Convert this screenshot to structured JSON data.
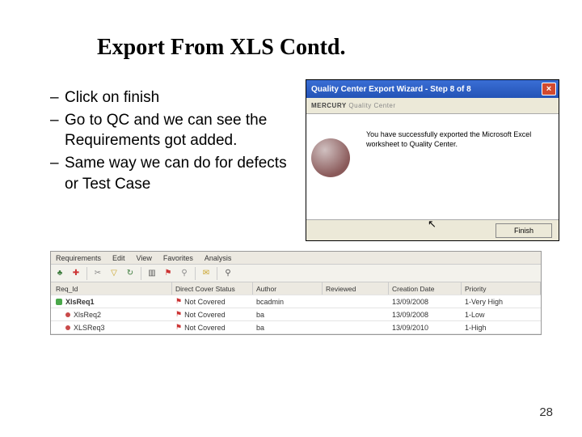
{
  "slide": {
    "title": "Export From XLS Contd.",
    "bullets": [
      "Click on finish",
      "Go to QC and we can see the Requirements got added.",
      "Same way we can do for defects or Test Case"
    ],
    "page_number": "28"
  },
  "dialog": {
    "title": "Quality Center Export Wizard - Step 8 of 8",
    "brand": "MERCURY",
    "brand_sub": "Quality Center",
    "message": "You have successfully exported the Microsoft Excel worksheet to Quality Center.",
    "finish_label": "Finish"
  },
  "qc": {
    "menu": [
      "Requirements",
      "Edit",
      "View",
      "Favorites",
      "Analysis"
    ],
    "columns": [
      "Req_Id",
      "Direct Cover Status",
      "Author",
      "Reviewed",
      "Creation Date",
      "Priority"
    ],
    "rows": [
      {
        "icon": "folder",
        "name": "XlsReq1",
        "cover": "Not Covered",
        "author": "bcadmin",
        "reviewed": "",
        "date": "13/09/2008",
        "priority": "1-Very High"
      },
      {
        "icon": "item",
        "name": "XlsReq2",
        "cover": "Not Covered",
        "author": "ba",
        "reviewed": "",
        "date": "13/09/2008",
        "priority": "1-Low"
      },
      {
        "icon": "item",
        "name": "XLSReq3",
        "cover": "Not Covered",
        "author": "ba",
        "reviewed": "",
        "date": "13/09/2010",
        "priority": "1-High"
      }
    ]
  }
}
